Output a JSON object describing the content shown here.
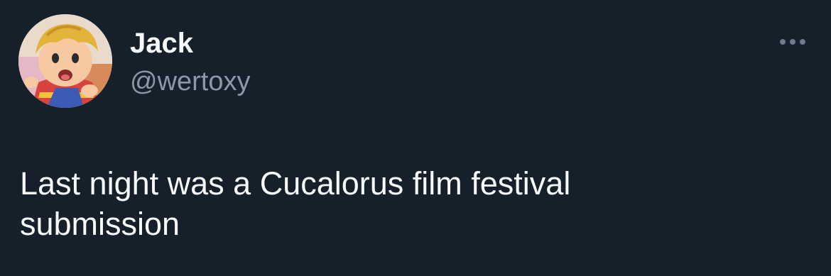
{
  "tweet": {
    "author": {
      "display_name": "Jack",
      "handle": "@wertoxy",
      "avatar_icon": "avatar-cartoon-boy"
    },
    "more_icon": "more-horizontal-icon",
    "text": "Last night was a Cucalorus film festival\nsubmission"
  },
  "colors": {
    "background": "#15202b",
    "primary_text": "#f7f9f9",
    "secondary_text": "#8b98a5"
  }
}
